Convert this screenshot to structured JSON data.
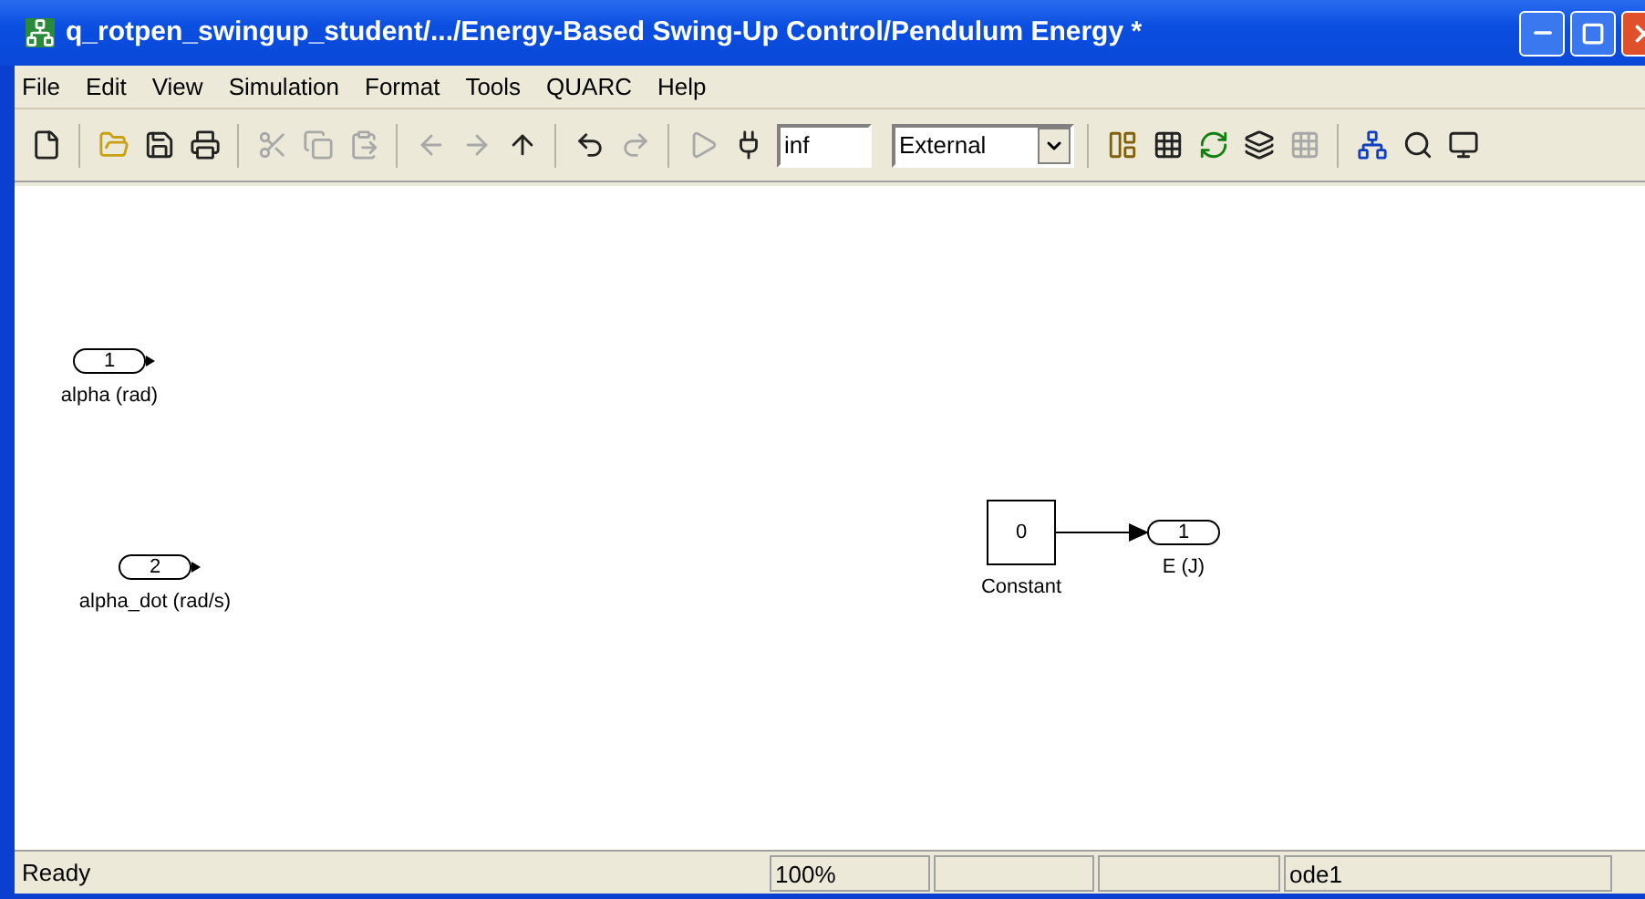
{
  "window": {
    "title": "q_rotpen_swingup_student/.../Energy-Based Swing-Up Control/Pendulum Energy *"
  },
  "menu": [
    {
      "label": "File"
    },
    {
      "label": "Edit"
    },
    {
      "label": "View"
    },
    {
      "label": "Simulation"
    },
    {
      "label": "Format"
    },
    {
      "label": "Tools"
    },
    {
      "label": "QUARC"
    },
    {
      "label": "Help"
    }
  ],
  "toolbar": {
    "stop_time": "inf",
    "mode": "External"
  },
  "blocks": [
    {
      "kind": "inport",
      "number": "1",
      "label": "alpha (rad)"
    },
    {
      "kind": "inport",
      "number": "2",
      "label": "alpha_dot (rad/s)"
    },
    {
      "kind": "constant",
      "value": "0",
      "label": "Constant"
    },
    {
      "kind": "outport",
      "number": "1",
      "label": "E (J)"
    }
  ],
  "status_bar": {
    "status": "Ready",
    "zoom": "100%",
    "solver": "ode1"
  }
}
